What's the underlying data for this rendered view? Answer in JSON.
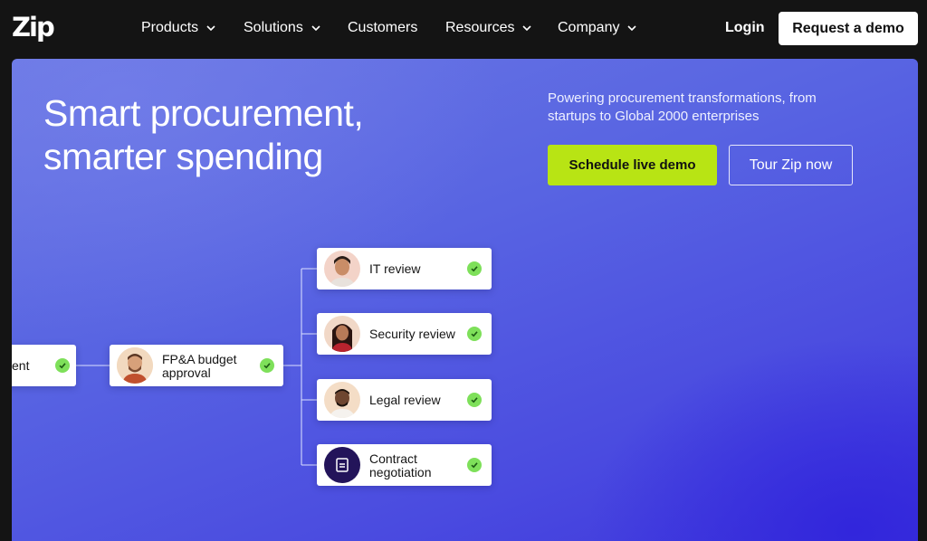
{
  "brand": {
    "logo_text": "Zip"
  },
  "nav": {
    "items": [
      {
        "label": "Products",
        "has_dropdown": true
      },
      {
        "label": "Solutions",
        "has_dropdown": true
      },
      {
        "label": "Customers",
        "has_dropdown": false
      },
      {
        "label": "Resources",
        "has_dropdown": true
      },
      {
        "label": "Company",
        "has_dropdown": true
      }
    ],
    "login_label": "Login",
    "demo_label": "Request a demo"
  },
  "hero": {
    "headline": "Smart procurement, smarter spending",
    "subheadline": "Powering procurement transformations, from startups to Global 2000 enterprises",
    "primary_cta": "Schedule live demo",
    "secondary_cta": "Tour Zip now"
  },
  "workflow": {
    "partial_step": {
      "label": "ent",
      "status": "approved"
    },
    "budget_step": {
      "label": "FP&A budget approval",
      "status": "approved"
    },
    "reviews": [
      {
        "label": "IT review",
        "status": "approved",
        "icon": "person-avatar"
      },
      {
        "label": "Security review",
        "status": "approved",
        "icon": "person-avatar"
      },
      {
        "label": "Legal review",
        "status": "approved",
        "icon": "person-avatar"
      },
      {
        "label": "Contract negotiation",
        "status": "approved",
        "icon": "document-icon"
      }
    ]
  },
  "colors": {
    "nav_bg": "#141414",
    "hero_blue": "#5864e2",
    "accent_green": "#b8e414",
    "check_green": "#7ee05a",
    "contract_icon_bg": "#23145a"
  }
}
